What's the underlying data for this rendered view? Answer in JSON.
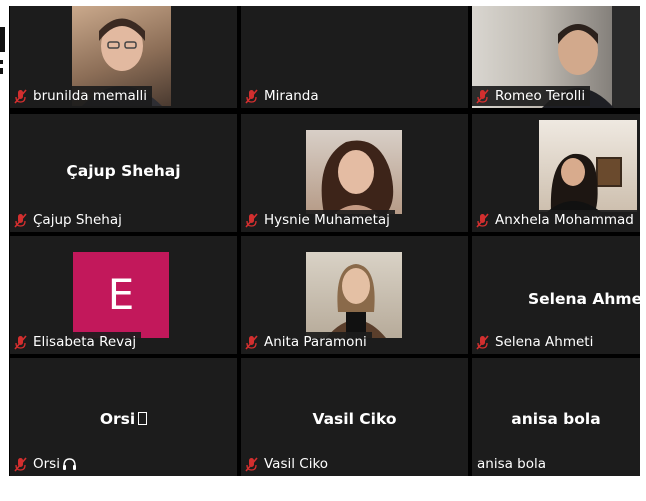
{
  "participants": [
    {
      "id": "brunilda",
      "label": "brunilda memalli",
      "muted": true,
      "display": "video"
    },
    {
      "id": "miranda",
      "label": "Miranda",
      "muted": true,
      "display": "blank"
    },
    {
      "id": "romeo",
      "label": "Romeo Terolli",
      "muted": true,
      "display": "video"
    },
    {
      "id": "cajup",
      "label": "Çajup Shehaj",
      "muted": true,
      "display": "name",
      "center_name": "Çajup Shehaj"
    },
    {
      "id": "hysnie",
      "label": "Hysnie Muhametaj",
      "muted": true,
      "display": "video"
    },
    {
      "id": "anxhela",
      "label": "Anxhela Mohammad",
      "muted": true,
      "display": "video"
    },
    {
      "id": "elisabeta",
      "label": "Elisabeta Revaj",
      "muted": true,
      "display": "avatar",
      "avatar_letter": "E",
      "avatar_color": "#c2185b"
    },
    {
      "id": "anita",
      "label": "Anita Paramoni",
      "muted": true,
      "display": "video"
    },
    {
      "id": "selena",
      "label": "Selena Ahmeti",
      "muted": true,
      "display": "name",
      "center_name": "Selena Ahmeti"
    },
    {
      "id": "orsi",
      "label": "Orsi",
      "muted": true,
      "display": "name",
      "center_name": "Orsi"
    },
    {
      "id": "vasil",
      "label": "Vasil Ciko",
      "muted": true,
      "display": "name",
      "center_name": "Vasil Ciko"
    },
    {
      "id": "anisa",
      "label": "anisa bola",
      "muted": false,
      "display": "name",
      "center_name": "anisa bola"
    }
  ],
  "colors": {
    "grid_bg": "#000000",
    "tile_bg": "#1c1c1c",
    "mute_icon": "#d32f2f",
    "text": "#ffffff"
  },
  "icons": {
    "mute": "microphone-muted-icon",
    "orsi_tag": "headset-icon"
  }
}
